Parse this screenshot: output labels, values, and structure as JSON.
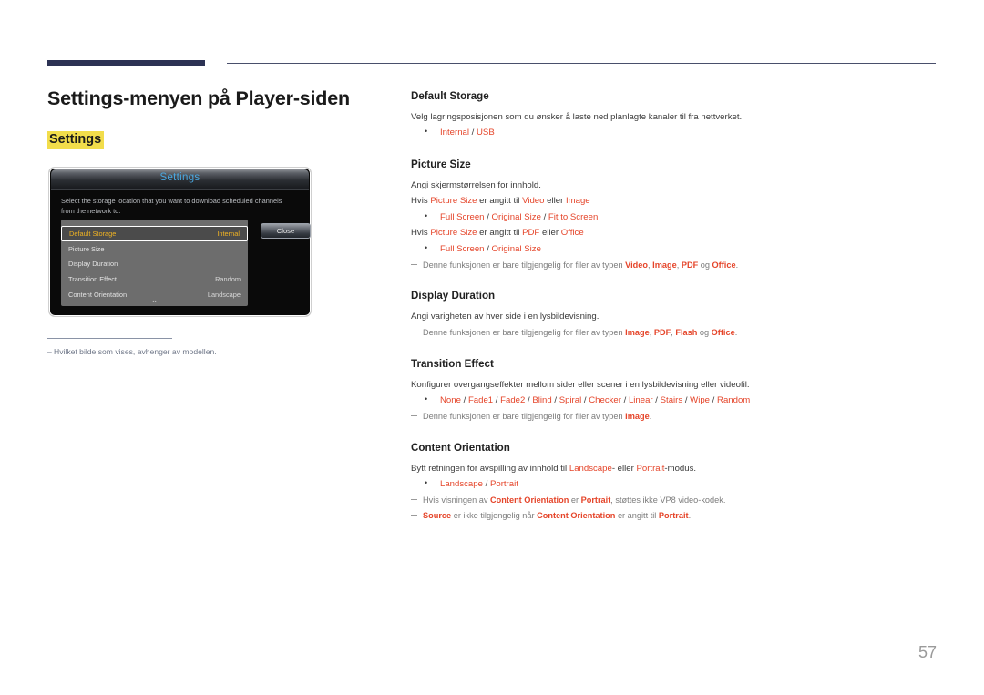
{
  "page": {
    "title": "Settings-menyen på Player-siden",
    "subtitle": "Settings",
    "number": "57"
  },
  "colors": {
    "accent_orange": "#e5452a",
    "highlight_yellow": "#f2dd4b",
    "rule_navy": "#2c3254",
    "osd_title_cyan": "#49a7e0",
    "osd_selected_amber": "#f0b323"
  },
  "osd": {
    "title": "Settings",
    "description": "Select the storage location that you want to download scheduled channels from the network to.",
    "close_label": "Close",
    "chevron": "chevron-down-icon",
    "rows": [
      {
        "label": "Default Storage",
        "value": "Internal",
        "selected": true
      },
      {
        "label": "Picture Size",
        "value": "",
        "selected": false
      },
      {
        "label": "Display Duration",
        "value": "",
        "selected": false
      },
      {
        "label": "Transition Effect",
        "value": "Random",
        "selected": false
      },
      {
        "label": "Content Orientation",
        "value": "Landscape",
        "selected": false
      }
    ]
  },
  "figure_note": {
    "dash": "–",
    "text": "Hvilket bilde som vises, avhenger av modellen."
  },
  "sections": {
    "default_storage": {
      "heading": "Default Storage",
      "body": "Velg lagringsposisjonen som du ønsker å laste ned planlagte kanaler til fra nettverket.",
      "options": {
        "a": "Internal",
        "sep": " / ",
        "b": "USB"
      }
    },
    "picture_size": {
      "heading": "Picture Size",
      "body": "Angi skjermstørrelsen for innhold.",
      "cond1": {
        "pre": "Hvis ",
        "term": "Picture Size",
        "mid": " er angitt til ",
        "v1": "Video",
        "eller": " eller ",
        "v2": "Image"
      },
      "opts1": {
        "a": "Full Screen",
        "b": "Original Size",
        "c": "Fit to Screen"
      },
      "cond2": {
        "pre": "Hvis ",
        "term": "Picture Size",
        "mid": " er angitt til ",
        "v1": "PDF",
        "eller": " eller ",
        "v2": "Office"
      },
      "opts2": {
        "a": "Full Screen",
        "b": "Original Size"
      },
      "note": {
        "pre": "Denne funksjonen er bare tilgjengelig for filer av typen ",
        "t1": "Video",
        "t2": "Image",
        "t3": "PDF",
        "og": " og ",
        "t4": "Office",
        "end": "."
      }
    },
    "display_duration": {
      "heading": "Display Duration",
      "body": "Angi varigheten av hver side i en lysbildevisning.",
      "note": {
        "pre": "Denne funksjonen er bare tilgjengelig for filer av typen ",
        "t1": "Image",
        "t2": "PDF",
        "t3": "Flash",
        "og": " og ",
        "t4": "Office",
        "end": "."
      }
    },
    "transition_effect": {
      "heading": "Transition Effect",
      "body": "Konfigurer overgangseffekter mellom sider eller scener i en lysbildevisning eller videofil.",
      "options": [
        "None",
        "Fade1",
        "Fade2",
        "Blind",
        "Spiral",
        "Checker",
        "Linear",
        "Stairs",
        "Wipe",
        "Random"
      ],
      "note": {
        "pre": "Denne funksjonen er bare tilgjengelig for filer av typen ",
        "t1": "Image",
        "end": "."
      }
    },
    "content_orientation": {
      "heading": "Content Orientation",
      "body": {
        "pre": "Bytt retningen for avspilling av innhold til ",
        "t1": "Landscape",
        "mid": "- eller ",
        "t2": "Portrait",
        "end": "-modus."
      },
      "options": {
        "a": "Landscape",
        "b": "Portrait"
      },
      "note1": {
        "pre": "Hvis visningen av ",
        "t1": "Content Orientation",
        "mid": " er ",
        "t2": "Portrait",
        "end": ", støttes ikke VP8 video-kodek."
      },
      "note2": {
        "t1": "Source",
        "mid1": " er ikke tilgjengelig når ",
        "t2": "Content Orientation",
        "mid2": " er angitt til ",
        "t3": "Portrait",
        "end": "."
      }
    }
  }
}
